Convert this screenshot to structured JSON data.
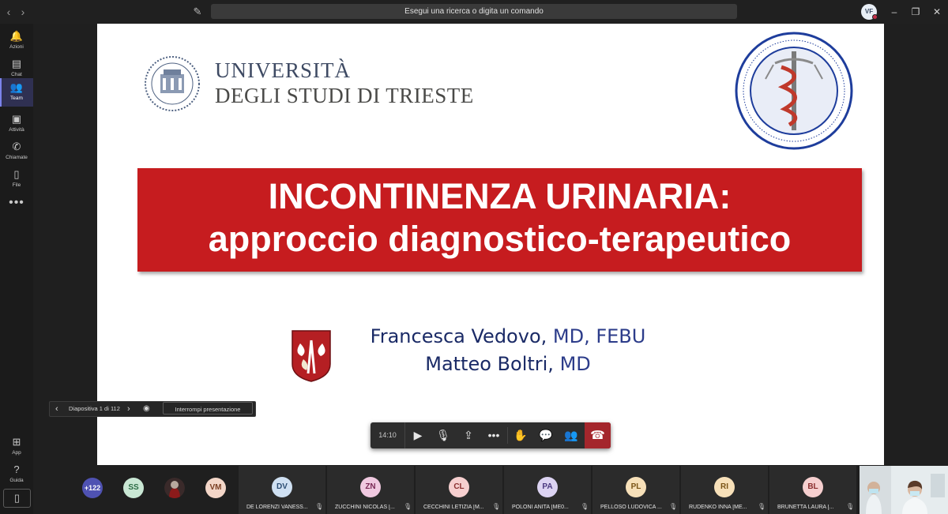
{
  "titlebar": {
    "back_icon": "chevron-left-icon",
    "forward_icon": "chevron-right-icon",
    "compose_icon": "compose-icon",
    "search_placeholder": "Esegui una ricerca o digita un comando",
    "user_initials": "VF",
    "minimize": "–",
    "restore": "❐",
    "close": "✕"
  },
  "rail": {
    "items": [
      {
        "label": "Azioni",
        "icon": "bell-icon",
        "glyph": "🔔"
      },
      {
        "label": "Chat",
        "icon": "chat-icon",
        "glyph": "▤"
      },
      {
        "label": "Team",
        "icon": "teams-icon",
        "glyph": "👥"
      },
      {
        "label": "Attività",
        "icon": "assignments-icon",
        "glyph": "▣"
      },
      {
        "label": "Chiamate",
        "icon": "phone-icon",
        "glyph": "✆"
      },
      {
        "label": "File",
        "icon": "file-icon",
        "glyph": "▯"
      }
    ],
    "more": "•••",
    "bottom_items": [
      {
        "label": "App",
        "icon": "apps-icon",
        "glyph": "⊞"
      },
      {
        "label": "Guida",
        "icon": "help-icon",
        "glyph": "?"
      }
    ],
    "device_icon": "mobile-icon"
  },
  "slide": {
    "university_line1": "UNIVERSITÀ",
    "university_line2": "DEGLI STUDI DI TRIESTE",
    "title_line1": "INCONTINENZA URINARIA:",
    "title_line2": "approccio diagnostico-terapeutico",
    "author1_name": "Francesca Vedovo,",
    "author1_cred": " MD, FEBU",
    "author2_name": "Matteo Boltri,",
    "author2_cred": " MD"
  },
  "presentation": {
    "slide_counter": "Diapositiva 1 di 112",
    "stop_label": "Interrompi presentazione"
  },
  "meeting_bar": {
    "timer": "14:10"
  },
  "participants": {
    "overflow": "+122",
    "compact": [
      {
        "initials": "SS",
        "bg": "#c9e7d4",
        "fg": "#2b6b45"
      },
      {
        "initials": "VM",
        "bg": "#f3d6c8",
        "fg": "#7a3e22"
      }
    ],
    "tiles": [
      {
        "initials": "DV",
        "name": "DE LORENZI VANESS...",
        "bg": "#cfe0f2",
        "fg": "#2c4d73"
      },
      {
        "initials": "ZN",
        "name": "ZUCCHINI NICOLAS [...",
        "bg": "#f0c9e0",
        "fg": "#7a2a56"
      },
      {
        "initials": "CL",
        "name": "CECCHINI LETIZIA [M...",
        "bg": "#f6cfcf",
        "fg": "#8a2e2e"
      },
      {
        "initials": "PA",
        "name": "POLONI ANITA [ME0...",
        "bg": "#dcd3f2",
        "fg": "#4b3a80"
      },
      {
        "initials": "PL",
        "name": "PELLOSO LUDOVICA ...",
        "bg": "#f7e0b9",
        "fg": "#7a5416"
      },
      {
        "initials": "RI",
        "name": "RUDENKO INNA [ME...",
        "bg": "#f7e0b9",
        "fg": "#7a5416"
      },
      {
        "initials": "BL",
        "name": "BRUNETTA LAURA [...",
        "bg": "#f6cfcf",
        "fg": "#8a2e2e"
      }
    ]
  },
  "colors": {
    "accent": "#7b83eb",
    "hangup": "#a4262c",
    "title_red": "#c61c1f"
  }
}
